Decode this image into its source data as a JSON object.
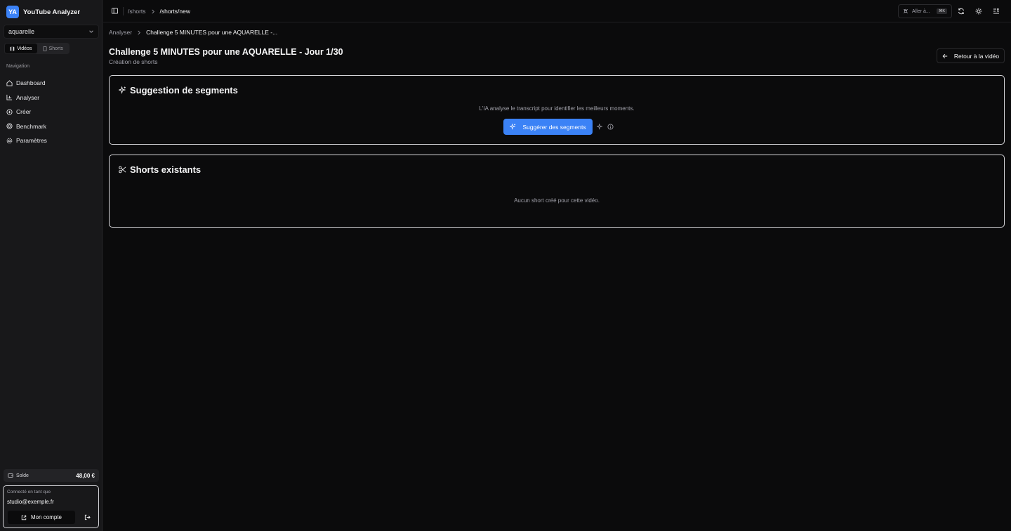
{
  "app": {
    "logo_text": "YA",
    "name": "YouTube Analyzer"
  },
  "sidebar": {
    "channel_select": {
      "value": "aquarelle"
    },
    "content_toggle": {
      "videos_label": "Vidéos",
      "shorts_label": "Shorts",
      "active": "videos"
    },
    "nav_heading": "Navigation",
    "nav_items": [
      {
        "label": "Dashboard",
        "icon": "home-icon"
      },
      {
        "label": "Analyser",
        "icon": "chart-icon"
      },
      {
        "label": "Créer",
        "icon": "plus-circle-icon"
      },
      {
        "label": "Benchmark",
        "icon": "target-icon"
      },
      {
        "label": "Paramètres",
        "icon": "gear-icon"
      }
    ],
    "balance": {
      "label": "Solde",
      "amount": "48,00 €"
    },
    "account": {
      "label": "Connecté en tant que",
      "email": "studio@exemple.fr",
      "button_label": "Mon compte"
    }
  },
  "topbar": {
    "crumbs": [
      "/shorts",
      "/shorts/new"
    ],
    "search_label": "Aller à...",
    "search_shortcut": "⌘K"
  },
  "main": {
    "breadcrumb": [
      "Analyser",
      "Challenge 5 MINUTES pour une AQUARELLE -..."
    ],
    "title": "Challenge 5 MINUTES pour une AQUARELLE - Jour 1/30",
    "subtitle": "Création de shorts",
    "back_button": "Retour à la vidéo",
    "suggestion_card": {
      "title": "Suggestion de segments",
      "description": "L'IA analyse le transcript pour identifier les meilleurs moments.",
      "button_label": "Suggérer des segments"
    },
    "shorts_card": {
      "title": "Shorts existants",
      "empty_text": "Aucun short créé pour cette vidéo."
    }
  },
  "colors": {
    "accent": "#3b82f6",
    "background": "#0b0b0c",
    "sidebar": "#18181a"
  }
}
